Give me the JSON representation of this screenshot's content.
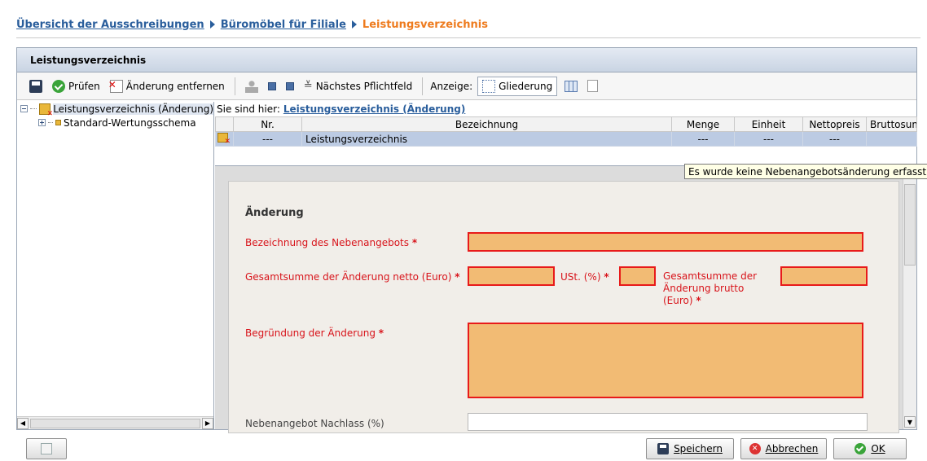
{
  "breadcrumb": {
    "items": [
      "Übersicht der Ausschreibungen",
      "Büromöbel für Filiale"
    ],
    "current": "Leistungsverzeichnis"
  },
  "panel": {
    "title": "Leistungsverzeichnis"
  },
  "toolbar": {
    "save_icon": "save-icon",
    "check_label": "Prüfen",
    "remove_label": "Änderung entfernen",
    "next_required_label": "Nächstes Pflichtfeld",
    "view_label": "Anzeige:",
    "outline_label": "Gliederung"
  },
  "tree": {
    "root_label": "Leistungsverzeichnis (Änderung)",
    "child_label": "Standard-Wertungsschema"
  },
  "location": {
    "prefix": "Sie sind hier:",
    "value": "Leistungsverzeichnis (Änderung)"
  },
  "table": {
    "columns": [
      "",
      "Nr.",
      "Bezeichnung",
      "Menge",
      "Einheit",
      "Nettopreis",
      "Bruttosum..."
    ],
    "rows": [
      {
        "nr": "---",
        "bezeichnung": "Leistungsverzeichnis",
        "menge": "---",
        "einheit": "---",
        "netto": "---",
        "brutto": ""
      }
    ]
  },
  "tooltip": "Es wurde keine Nebenangebotsänderung erfasst!",
  "form": {
    "section_title": "Änderung",
    "bezeichnung_label": "Bezeichnung des Nebenangebots",
    "netto_label": "Gesamtsumme der Änderung netto (Euro)",
    "ust_label": "USt. (%)",
    "brutto_label_1": "Gesamtsumme der",
    "brutto_label_2": "Änderung brutto",
    "brutto_label_3": "(Euro)",
    "begruendung_label": "Begründung der Änderung",
    "nachlass_label": "Nebenangebot Nachlass (%)",
    "required_marker": "*"
  },
  "buttons": {
    "save": "Speichern",
    "cancel": "Abbrechen",
    "ok": "OK"
  },
  "colors": {
    "link": "#2a5e9c",
    "current": "#ee7b1e",
    "required_text": "#d8141b",
    "required_field_bg": "#f2bb74",
    "required_field_border": "#e81a1a",
    "selected_row": "#bccbe3"
  }
}
